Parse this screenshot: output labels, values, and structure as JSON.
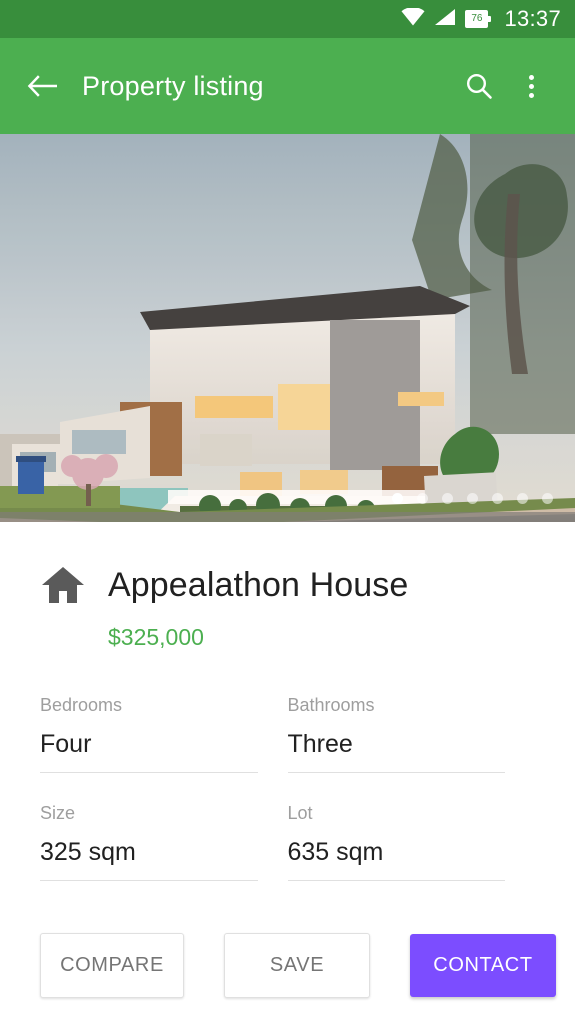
{
  "statusbar": {
    "time": "13:37",
    "battery_level": "76",
    "icons": [
      "wifi-icon",
      "signal-icon",
      "battery-icon"
    ]
  },
  "appbar": {
    "title": "Property listing",
    "back_icon": "back-arrow-icon",
    "search_icon": "search-icon",
    "overflow_icon": "more-vertical-icon"
  },
  "hero": {
    "alt": "modern two-storey house exterior at dusk",
    "pager": {
      "count": 7,
      "active_index": 0
    }
  },
  "property": {
    "icon": "home-icon",
    "name": "Appealathon House",
    "price": "$325,000",
    "specs": [
      {
        "label": "Bedrooms",
        "value": "Four"
      },
      {
        "label": "Bathrooms",
        "value": "Three"
      },
      {
        "label": "Size",
        "value": "325 sqm"
      },
      {
        "label": "Lot",
        "value": "635 sqm"
      }
    ]
  },
  "actions": {
    "compare": "COMPARE",
    "save": "SAVE",
    "contact": "CONTACT"
  },
  "colors": {
    "status_bar": "#388e3c",
    "app_bar": "#4caf50",
    "price": "#4caf50",
    "contact_button": "#7c4dff"
  }
}
